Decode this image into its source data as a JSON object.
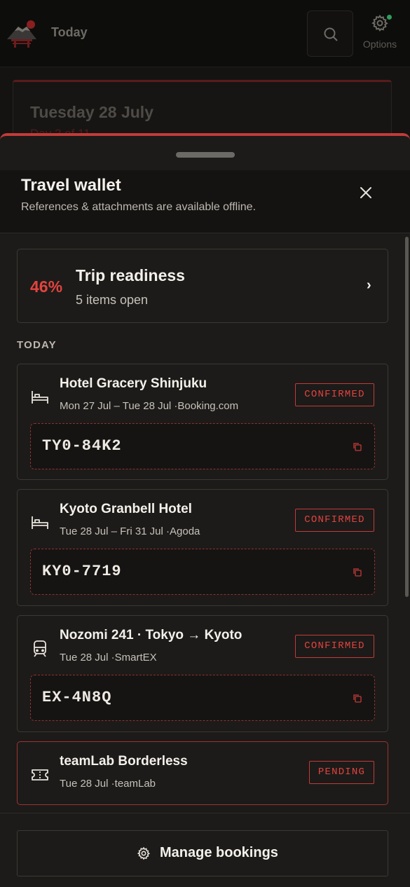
{
  "app": {
    "title": "Today",
    "options_label": "Options",
    "bg_date": "Tuesday 28 July",
    "bg_sub": "Day 2 of 11"
  },
  "sheet": {
    "title": "Travel wallet",
    "subtitle": "References & attachments are available offline."
  },
  "readiness": {
    "percent": "46%",
    "title": "Trip readiness",
    "subtitle": "5 items open",
    "chevron": "›"
  },
  "section_label": "TODAY",
  "bookings": [
    {
      "icon": "bed-icon",
      "name": "Hotel Gracery Shinjuku",
      "meta": "Mon 27 Jul – Tue 28 Jul  ·Booking.com",
      "status": "CONFIRMED",
      "ref": "TY0-84K2"
    },
    {
      "icon": "bed-icon",
      "name": "Kyoto Granbell Hotel",
      "meta": "Tue 28 Jul – Fri 31 Jul  ·Agoda",
      "status": "CONFIRMED",
      "ref": "KY0-7719"
    },
    {
      "icon": "train-icon",
      "name": "Nozomi 241 · Tokyo → Kyoto",
      "meta": "Tue 28 Jul  ·SmartEX",
      "status": "CONFIRMED",
      "ref": "EX-4N8Q"
    },
    {
      "icon": "ticket-icon",
      "name": "teamLab Borderless",
      "meta": "Tue 28 Jul  ·teamLab",
      "status": "PENDING"
    }
  ],
  "footer": {
    "manage_label": "Manage bookings"
  },
  "colors": {
    "accent": "#c23b38",
    "accent_text": "#e2433f",
    "sheet_bg": "#1c1b19",
    "border": "#3b3935"
  }
}
